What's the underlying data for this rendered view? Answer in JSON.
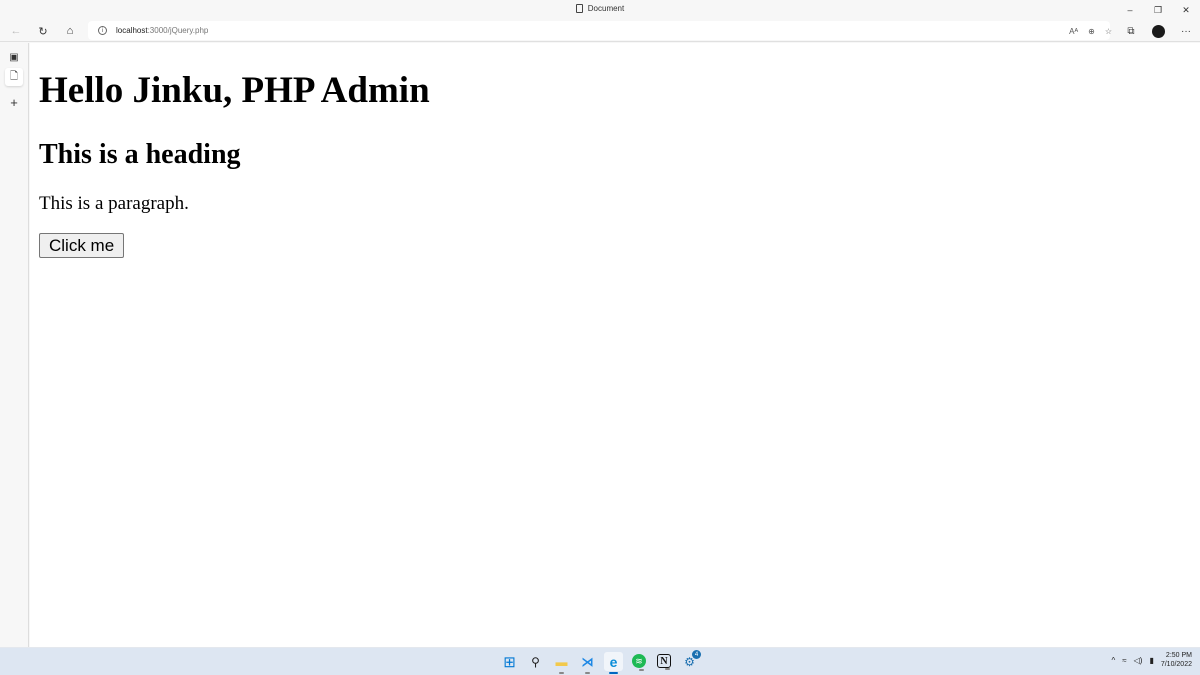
{
  "window": {
    "title": "Document",
    "minimize_glyph": "–",
    "maximize_glyph": "❐",
    "close_glyph": "✕"
  },
  "toolbar": {
    "back_icon": "←",
    "refresh_icon": "↻",
    "home_icon": "⌂",
    "info_icon": "i",
    "url_host": "localhost",
    "url_path": ":3000/jQuery.php",
    "read_aloud_icon": "Aᴬ",
    "zoom_icon": "⊕",
    "favorites_icon": "☆",
    "collections_icon": "⧉",
    "more_icon": "···"
  },
  "sidebar": {
    "items": [
      {
        "name": "tab-actions",
        "glyph": "▣"
      },
      {
        "name": "document-tab",
        "glyph": "🗋"
      },
      {
        "name": "new-tab",
        "glyph": "+"
      }
    ]
  },
  "page": {
    "h1": "Hello Jinku, PHP Admin",
    "h2": "This is a heading",
    "paragraph": "This is a paragraph.",
    "button_label": "Click me"
  },
  "taskbar": {
    "apps": [
      {
        "name": "start",
        "glyph": "⊞",
        "color": "#0078d4"
      },
      {
        "name": "search",
        "glyph": "⚲",
        "color": "#222222"
      },
      {
        "name": "file-explorer",
        "glyph": "▬",
        "color": "#f2c94c"
      },
      {
        "name": "vscode",
        "glyph": "⋊",
        "color": "#1e88e5"
      },
      {
        "name": "edge",
        "glyph": "e",
        "color": "#0c8ed9"
      },
      {
        "name": "spotify",
        "glyph": "≋",
        "color": "#1db954"
      },
      {
        "name": "notion",
        "glyph": "N",
        "color": "#111111"
      },
      {
        "name": "steam",
        "glyph": "⚙",
        "color": "#1a6fb0"
      }
    ],
    "steam_badge": "4",
    "tray_chevron": "^",
    "wifi_icon": "≈",
    "volume_icon": "◁)",
    "battery_icon": "▮",
    "time": "2:50 PM",
    "date": "7/10/2022"
  }
}
